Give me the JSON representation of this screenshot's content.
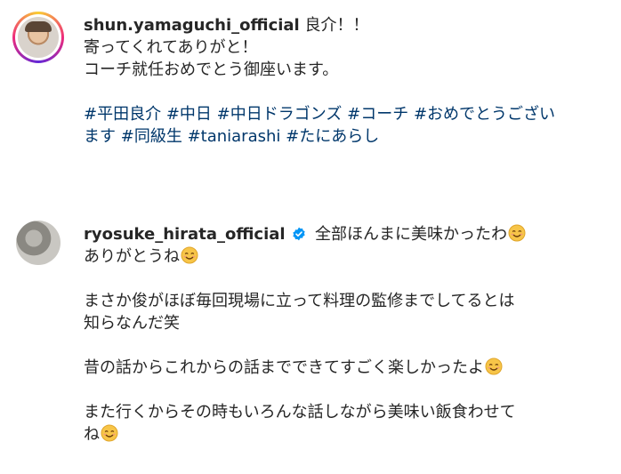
{
  "post1": {
    "username": "shun.yamaguchi_official",
    "lines": [
      "良介！！",
      "寄ってくれてありがと！",
      "コーチ就任おめでとう御座います。"
    ],
    "hashtags_line1": [
      "#平田良介",
      "#中日",
      "#中日ドラゴンズ",
      "#コーチ",
      "#おめでとうござい"
    ],
    "hashtags_line2": [
      "ます",
      "#同級生",
      "#taniarashi",
      "#たにあらし"
    ]
  },
  "post2": {
    "username": "ryosuke_hirata_official",
    "first_text": "全部ほんまに美味かったわ",
    "line2": "ありがとうね",
    "line3": "まさか俊がほぼ毎回現場に立って料理の監修までしてるとは",
    "line4": "知らなんだ笑",
    "line5": "昔の話からこれからの話までできてすごく楽しかったよ",
    "line6": "また行くからその時もいろんな話しながら美味い飯食わせて",
    "line7": "ね"
  },
  "colors": {
    "hashtag": "#00376b",
    "verified": "#0095f6",
    "emoji": "#f7c548"
  },
  "icons": {
    "verified": "verified-badge-icon",
    "emoji": "smiling-face-emoji"
  }
}
